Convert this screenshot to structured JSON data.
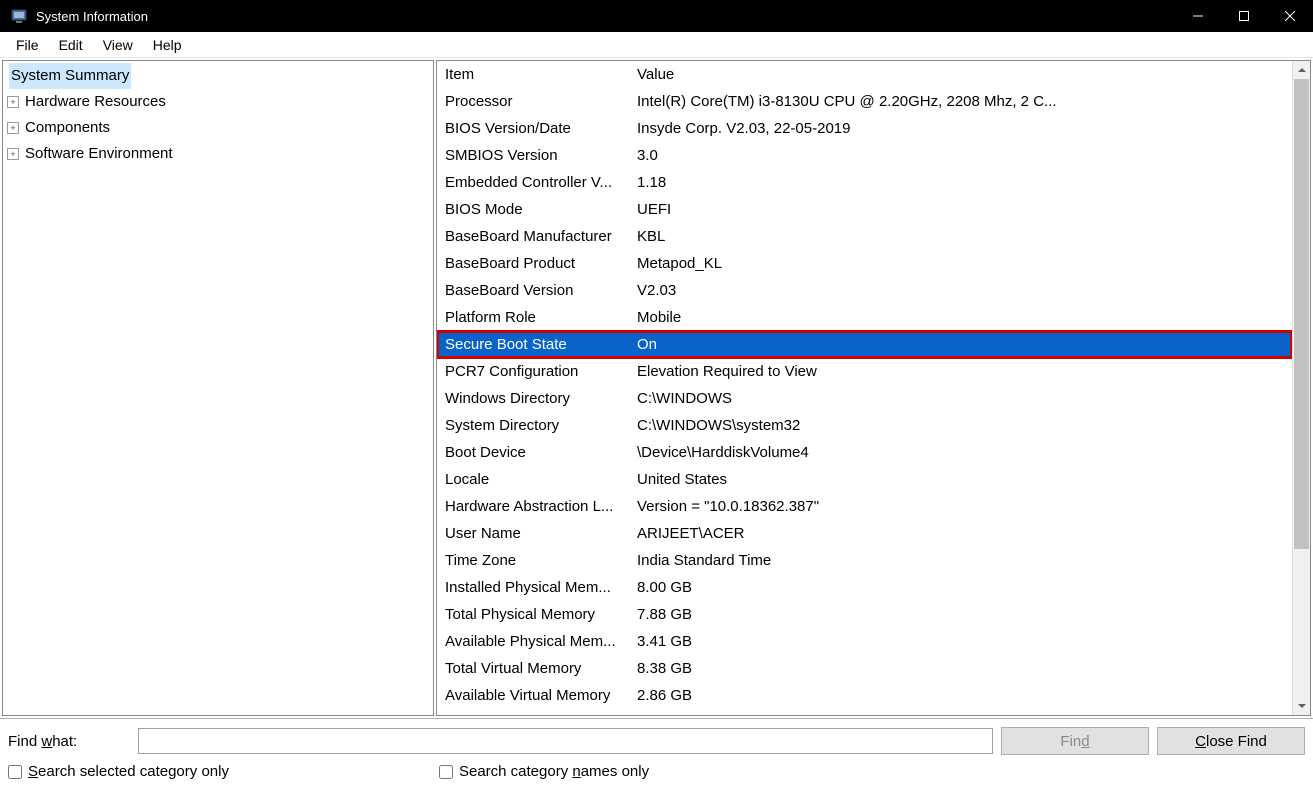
{
  "window": {
    "title": "System Information"
  },
  "menu": {
    "file": "File",
    "edit": "Edit",
    "view": "View",
    "help": "Help"
  },
  "tree": {
    "root": "System Summary",
    "items": [
      "Hardware Resources",
      "Components",
      "Software Environment"
    ]
  },
  "list": {
    "header_item": "Item",
    "header_value": "Value",
    "rows": [
      {
        "item": "Processor",
        "value": "Intel(R) Core(TM) i3-8130U CPU @ 2.20GHz, 2208 Mhz, 2 C..."
      },
      {
        "item": "BIOS Version/Date",
        "value": "Insyde Corp. V2.03, 22-05-2019"
      },
      {
        "item": "SMBIOS Version",
        "value": "3.0"
      },
      {
        "item": "Embedded Controller V...",
        "value": "1.18"
      },
      {
        "item": "BIOS Mode",
        "value": "UEFI"
      },
      {
        "item": "BaseBoard Manufacturer",
        "value": "KBL"
      },
      {
        "item": "BaseBoard Product",
        "value": "Metapod_KL"
      },
      {
        "item": "BaseBoard Version",
        "value": "V2.03"
      },
      {
        "item": "Platform Role",
        "value": "Mobile"
      },
      {
        "item": "Secure Boot State",
        "value": "On",
        "selected": true,
        "highlight": true
      },
      {
        "item": "PCR7 Configuration",
        "value": "Elevation Required to View"
      },
      {
        "item": "Windows Directory",
        "value": "C:\\WINDOWS"
      },
      {
        "item": "System Directory",
        "value": "C:\\WINDOWS\\system32"
      },
      {
        "item": "Boot Device",
        "value": "\\Device\\HarddiskVolume4"
      },
      {
        "item": "Locale",
        "value": "United States"
      },
      {
        "item": "Hardware Abstraction L...",
        "value": "Version = \"10.0.18362.387\""
      },
      {
        "item": "User Name",
        "value": "ARIJEET\\ACER"
      },
      {
        "item": "Time Zone",
        "value": "India Standard Time"
      },
      {
        "item": "Installed Physical Mem...",
        "value": "8.00 GB"
      },
      {
        "item": "Total Physical Memory",
        "value": "7.88 GB"
      },
      {
        "item": "Available Physical Mem...",
        "value": "3.41 GB"
      },
      {
        "item": "Total Virtual Memory",
        "value": "8.38 GB"
      },
      {
        "item": "Available Virtual Memory",
        "value": "2.86 GB"
      }
    ]
  },
  "search": {
    "label_pre": "Find ",
    "label_u": "w",
    "label_post": "hat:",
    "find_label": "Fin",
    "find_u": "d",
    "close_pre": "",
    "close_u": "C",
    "close_post": "lose Find",
    "chk1_pre": "",
    "chk1_u": "S",
    "chk1_post": "earch selected category only",
    "chk2_pre": "Search category ",
    "chk2_u": "n",
    "chk2_post": "ames only",
    "input_value": ""
  }
}
